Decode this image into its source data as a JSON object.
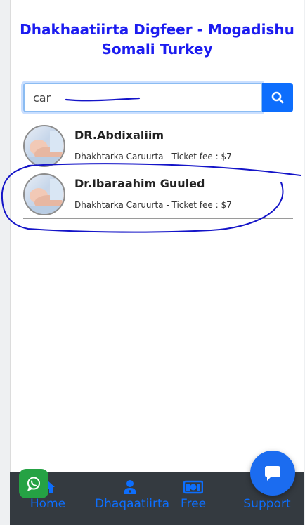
{
  "header": {
    "title_line1": "Dhakhaatiirta Digfeer - Mogadishu",
    "title_line2": "Somali Turkey"
  },
  "search": {
    "value": "car",
    "button_icon": "search-icon"
  },
  "doctors": [
    {
      "name": "DR.Abdixaliim",
      "info": "Dhakhtarka Caruurta - Ticket fee : $7",
      "avatar_icon": "doctor-photo"
    },
    {
      "name": "Dr.Ibaraahim Guuled",
      "info": "Dhakhtarka Caruurta - Ticket fee : $7",
      "avatar_icon": "doctor-photo"
    }
  ],
  "nav": {
    "items": [
      {
        "label": "Home",
        "icon": "home-icon"
      },
      {
        "label": "Dhaqaatiirta",
        "icon": "doctor-icon"
      },
      {
        "label": "Free",
        "icon": "money-icon"
      },
      {
        "label": "Support",
        "icon": "support-icon"
      }
    ]
  },
  "floating": {
    "whatsapp_icon": "whatsapp-icon",
    "chat_icon": "chat-icon"
  },
  "colors": {
    "title": "#1c1cf0",
    "accent": "#0d6efd",
    "nav_background": "#343a40",
    "whatsapp": "#25a244",
    "annotation_ink": "#1414c8"
  }
}
